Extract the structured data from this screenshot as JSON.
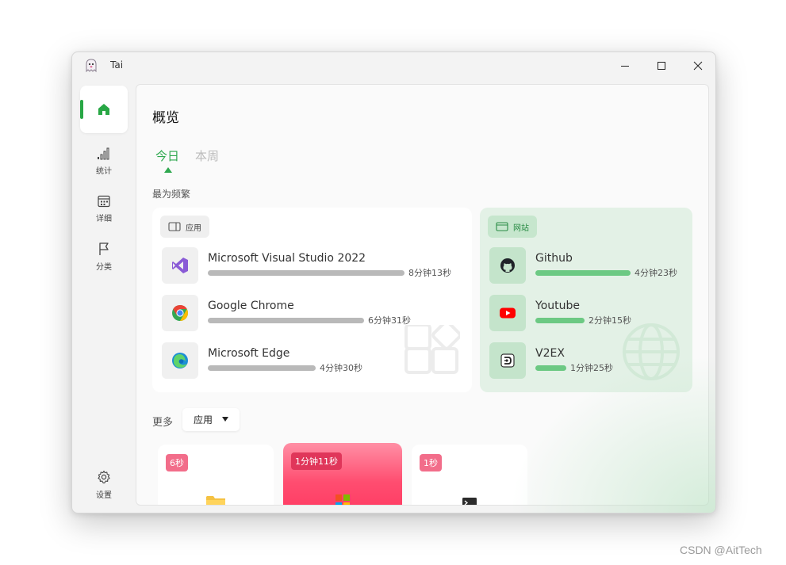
{
  "window": {
    "title": "Tai"
  },
  "nav": {
    "items": [
      {
        "id": "home",
        "label": ""
      },
      {
        "id": "stats",
        "label": "统计"
      },
      {
        "id": "details",
        "label": "详细"
      },
      {
        "id": "categories",
        "label": "分类"
      }
    ],
    "settings_label": "设置"
  },
  "page": {
    "title": "概览",
    "tabs": [
      {
        "label": "今日",
        "active": true
      },
      {
        "label": "本周",
        "active": false
      }
    ],
    "frequent_label": "最为频繁"
  },
  "apps_panel": {
    "chip_label": "应用",
    "items": [
      {
        "name": "Microsoft Visual Studio 2022",
        "time": "8分钟13秒",
        "icon": "visual-studio-icon",
        "seconds": 493
      },
      {
        "name": "Google Chrome",
        "time": "6分钟31秒",
        "icon": "chrome-icon",
        "seconds": 391
      },
      {
        "name": "Microsoft Edge",
        "time": "4分钟30秒",
        "icon": "edge-icon",
        "seconds": 270
      }
    ]
  },
  "sites_panel": {
    "chip_label": "网站",
    "items": [
      {
        "name": "Github",
        "time": "4分钟23秒",
        "icon": "github-icon",
        "seconds": 263
      },
      {
        "name": "Youtube",
        "time": "2分钟15秒",
        "icon": "youtube-icon",
        "seconds": 135
      },
      {
        "name": "V2EX",
        "time": "1分钟25秒",
        "icon": "v2ex-icon",
        "seconds": 85
      }
    ]
  },
  "more": {
    "label": "更多",
    "dropdown_value": "应用",
    "cards": [
      {
        "badge": "6秒",
        "icon": "folder-icon"
      },
      {
        "badge": "1分钟11秒",
        "icon": "windows-icon"
      },
      {
        "badge": "1秒",
        "icon": "terminal-icon"
      }
    ]
  },
  "footer_watermark": "CSDN @AitTech",
  "colors": {
    "accent": "#2fa84f",
    "site_bar": "#6cc983",
    "app_bar": "#b9b9b9",
    "hot_card": "#ff4d70"
  }
}
